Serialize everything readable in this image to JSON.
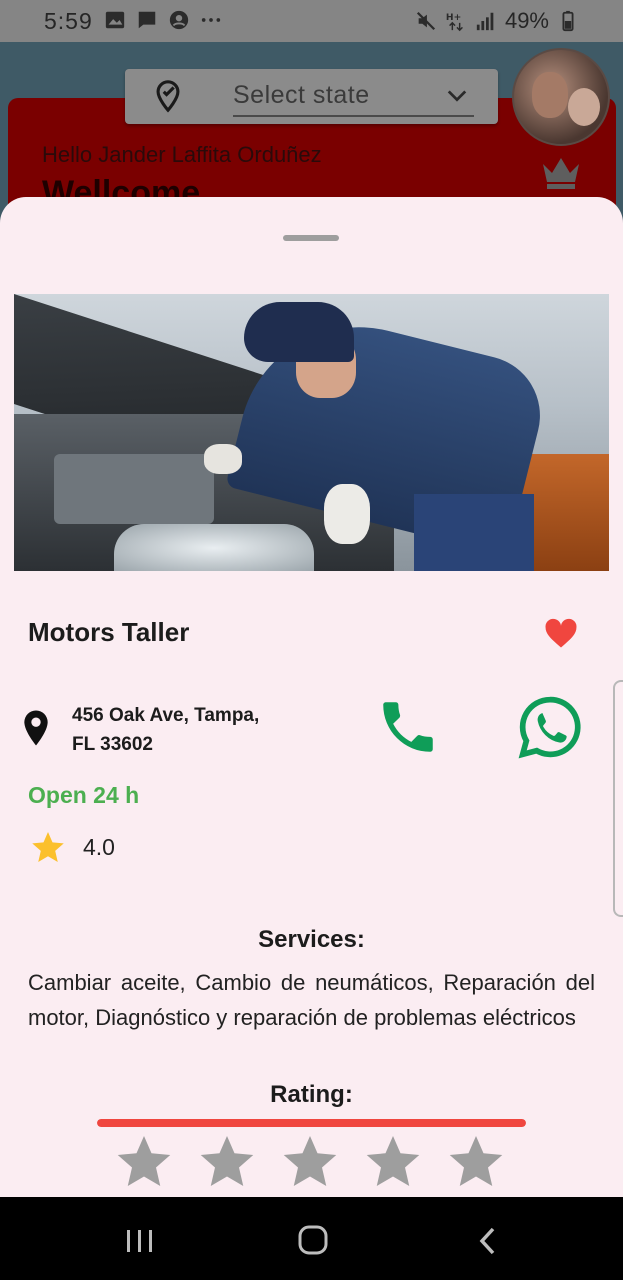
{
  "status_bar": {
    "time": "5:59",
    "battery": "49%",
    "icons": [
      "image-icon",
      "message-icon",
      "account-circle-icon",
      "more-icon",
      "mute-icon",
      "network-icon",
      "signal-icon",
      "battery-icon"
    ]
  },
  "background_app": {
    "state_select": {
      "placeholder": "Select state"
    },
    "greeting": "Hello Jander Laffita Orduñez",
    "welcome": "Wellcome"
  },
  "sheet": {
    "business_name": "Motors Taller",
    "favorite": true,
    "address_line1": "456 Oak Ave, Tampa,",
    "address_line2": "FL 33602",
    "hours": "Open 24 h",
    "rating": "4.0",
    "services_title": "Services:",
    "services": "Cambiar aceite, Cambio de neumáticos, Reparación del motor, Diagnóstico y reparación de problemas eléctricos",
    "rating_title": "Rating:",
    "rating_input": {
      "max_stars": 5,
      "selected": 0,
      "progress": 1.0
    }
  },
  "colors": {
    "accent_red": "#f0463f",
    "open_green": "#4caf50",
    "phone_green": "#0f9d58",
    "whatsapp_green": "#0f9d58",
    "star_gold": "#fbc02d",
    "star_empty": "#9e9e9e",
    "sheet_bg": "#fbedf2"
  }
}
